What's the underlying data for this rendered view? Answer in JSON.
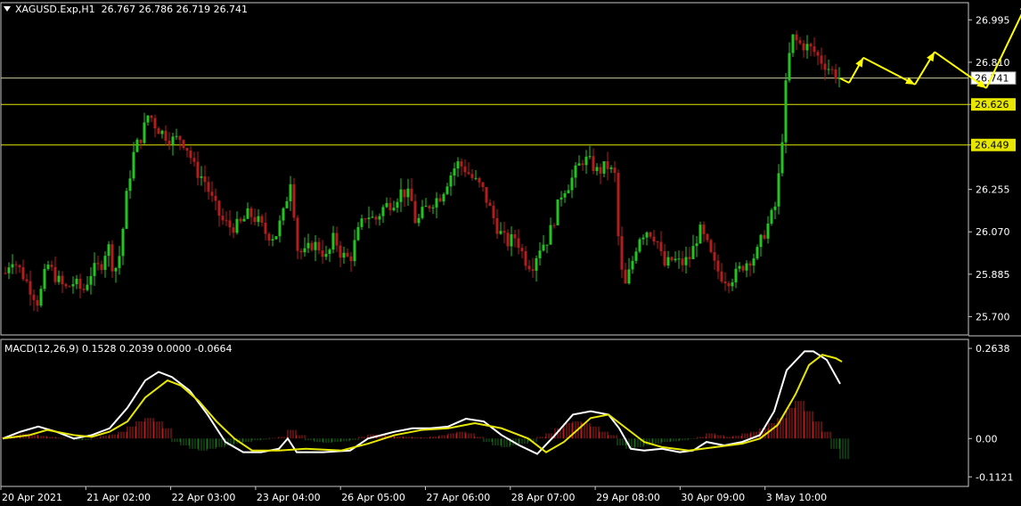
{
  "header": {
    "symbol": "XAGUSD.Exp,H1",
    "ohlc": "26.767 26.786 26.719 26.741"
  },
  "macd_header": "MACD(12,26,9) 0.1528 0.2039 0.0000 -0.0664",
  "colors": {
    "background": "#000000",
    "bull_candle": "#22c322",
    "bear_candle": "#b21e1e",
    "level_line": "#e6e600",
    "macd_line": "#ffffff",
    "signal_line": "#e6e600",
    "hist_positive": "#b21e1e",
    "hist_negative": "#1d6b1d",
    "axis_text": "#ffffff",
    "border": "#c8c8c8",
    "projection_arrow": "#ffff00"
  },
  "chart_data": [
    {
      "type": "candlestick",
      "title": "XAGUSD.Exp,H1",
      "price_axis_ticks": [
        26.995,
        26.81,
        26.626,
        26.449,
        26.255,
        26.07,
        25.885,
        25.7
      ],
      "ylim": [
        25.62,
        27.07
      ],
      "time_axis_labels": [
        "20 Apr 2021",
        "21 Apr 02:00",
        "22 Apr 03:00",
        "23 Apr 04:00",
        "26 Apr 05:00",
        "27 Apr 06:00",
        "28 Apr 07:00",
        "29 Apr 08:00",
        "30 Apr 09:00",
        "3 May 10:00"
      ],
      "current_price": 26.741,
      "horizontal_levels": [
        {
          "price": 26.741,
          "label": "26.741",
          "style": "price"
        },
        {
          "price": 26.626,
          "label": "26.626",
          "style": "level"
        },
        {
          "price": 26.449,
          "label": "26.449",
          "style": "level"
        }
      ],
      "price_path": [
        [
          0,
          25.86
        ],
        [
          10,
          25.96
        ],
        [
          20,
          25.9
        ],
        [
          30,
          25.83
        ],
        [
          40,
          25.76
        ],
        [
          50,
          25.93
        ],
        [
          60,
          25.87
        ],
        [
          70,
          25.82
        ],
        [
          80,
          25.85
        ],
        [
          90,
          25.81
        ],
        [
          100,
          25.9
        ],
        [
          110,
          25.92
        ],
        [
          118,
          26.02
        ],
        [
          125,
          25.89
        ],
        [
          132,
          25.98
        ],
        [
          140,
          26.26
        ],
        [
          148,
          26.43
        ],
        [
          156,
          26.49
        ],
        [
          164,
          26.59
        ],
        [
          172,
          26.53
        ],
        [
          180,
          26.5
        ],
        [
          190,
          26.47
        ],
        [
          200,
          26.48
        ],
        [
          208,
          26.43
        ],
        [
          216,
          26.34
        ],
        [
          226,
          26.3
        ],
        [
          236,
          26.2
        ],
        [
          246,
          26.12
        ],
        [
          256,
          26.09
        ],
        [
          266,
          26.1
        ],
        [
          276,
          26.15
        ],
        [
          286,
          26.12
        ],
        [
          296,
          26.06
        ],
        [
          306,
          26.05
        ],
        [
          316,
          26.16
        ],
        [
          324,
          26.32
        ],
        [
          330,
          26.0
        ],
        [
          338,
          25.97
        ],
        [
          348,
          26.02
        ],
        [
          356,
          26.0
        ],
        [
          364,
          25.95
        ],
        [
          372,
          26.05
        ],
        [
          380,
          25.97
        ],
        [
          390,
          25.95
        ],
        [
          398,
          26.06
        ],
        [
          408,
          26.15
        ],
        [
          418,
          26.12
        ],
        [
          428,
          26.18
        ],
        [
          438,
          26.2
        ],
        [
          448,
          26.25
        ],
        [
          458,
          26.22
        ],
        [
          464,
          26.1
        ],
        [
          472,
          26.16
        ],
        [
          482,
          26.2
        ],
        [
          492,
          26.23
        ],
        [
          500,
          26.3
        ],
        [
          510,
          26.37
        ],
        [
          518,
          26.35
        ],
        [
          528,
          26.3
        ],
        [
          538,
          26.26
        ],
        [
          546,
          26.18
        ],
        [
          556,
          26.08
        ],
        [
          566,
          26.02
        ],
        [
          576,
          26.05
        ],
        [
          586,
          25.95
        ],
        [
          594,
          25.92
        ],
        [
          602,
          26.0
        ],
        [
          612,
          26.04
        ],
        [
          620,
          26.14
        ],
        [
          628,
          26.25
        ],
        [
          636,
          26.28
        ],
        [
          644,
          26.34
        ],
        [
          652,
          26.39
        ],
        [
          660,
          26.37
        ],
        [
          668,
          26.33
        ],
        [
          678,
          26.36
        ],
        [
          688,
          26.31
        ],
        [
          692,
          25.96
        ],
        [
          698,
          25.82
        ],
        [
          706,
          25.93
        ],
        [
          714,
          26.05
        ],
        [
          724,
          26.08
        ],
        [
          734,
          26.04
        ],
        [
          742,
          25.92
        ],
        [
          752,
          25.95
        ],
        [
          762,
          25.93
        ],
        [
          772,
          25.96
        ],
        [
          782,
          26.08
        ],
        [
          790,
          26.02
        ],
        [
          798,
          25.93
        ],
        [
          806,
          25.88
        ],
        [
          814,
          25.86
        ],
        [
          822,
          25.88
        ],
        [
          830,
          25.92
        ],
        [
          838,
          25.95
        ],
        [
          846,
          25.97
        ],
        [
          852,
          26.04
        ],
        [
          860,
          26.11
        ],
        [
          868,
          26.19
        ],
        [
          874,
          26.43
        ],
        [
          880,
          26.76
        ],
        [
          886,
          26.92
        ],
        [
          894,
          26.89
        ],
        [
          902,
          26.88
        ],
        [
          910,
          26.86
        ],
        [
          918,
          26.82
        ],
        [
          926,
          26.79
        ],
        [
          934,
          26.76
        ],
        [
          940,
          26.74
        ]
      ],
      "projection_path": [
        [
          940,
          26.74
        ],
        [
          950,
          26.72
        ],
        [
          966,
          26.83
        ],
        [
          1024,
          26.713
        ],
        [
          1046,
          26.855
        ],
        [
          1104,
          26.697
        ],
        [
          1150,
          27.07
        ]
      ]
    },
    {
      "type": "line",
      "title": "MACD(12,26,9)",
      "y_axis_ticks": [
        0.2638,
        0.0,
        -0.1121
      ],
      "ylim": [
        -0.14,
        0.29
      ],
      "series": [
        {
          "name": "MACD",
          "values": [
            [
              0,
              0.0
            ],
            [
              20,
              0.02
            ],
            [
              40,
              0.035
            ],
            [
              60,
              0.02
            ],
            [
              80,
              0.0
            ],
            [
              100,
              0.01
            ],
            [
              120,
              0.03
            ],
            [
              140,
              0.09
            ],
            [
              160,
              0.17
            ],
            [
              175,
              0.195
            ],
            [
              190,
              0.18
            ],
            [
              210,
              0.14
            ],
            [
              230,
              0.07
            ],
            [
              250,
              -0.01
            ],
            [
              270,
              -0.04
            ],
            [
              290,
              -0.04
            ],
            [
              310,
              -0.03
            ],
            [
              320,
              0.0
            ],
            [
              330,
              -0.04
            ],
            [
              360,
              -0.04
            ],
            [
              390,
              -0.035
            ],
            [
              410,
              0.0
            ],
            [
              440,
              0.02
            ],
            [
              460,
              0.03
            ],
            [
              480,
              0.03
            ],
            [
              500,
              0.035
            ],
            [
              520,
              0.058
            ],
            [
              540,
              0.05
            ],
            [
              560,
              0.01
            ],
            [
              580,
              -0.02
            ],
            [
              600,
              -0.045
            ],
            [
              620,
              0.01
            ],
            [
              640,
              0.07
            ],
            [
              660,
              0.08
            ],
            [
              680,
              0.07
            ],
            [
              692,
              0.03
            ],
            [
              705,
              -0.03
            ],
            [
              720,
              -0.035
            ],
            [
              740,
              -0.03
            ],
            [
              760,
              -0.04
            ],
            [
              775,
              -0.035
            ],
            [
              790,
              -0.01
            ],
            [
              810,
              -0.02
            ],
            [
              830,
              -0.01
            ],
            [
              850,
              0.01
            ],
            [
              866,
              0.08
            ],
            [
              880,
              0.2
            ],
            [
              900,
              0.255
            ],
            [
              910,
              0.255
            ],
            [
              925,
              0.23
            ],
            [
              940,
              0.16
            ]
          ]
        },
        {
          "name": "Signal",
          "values": [
            [
              0,
              0.0
            ],
            [
              30,
              0.01
            ],
            [
              50,
              0.025
            ],
            [
              80,
              0.01
            ],
            [
              100,
              0.005
            ],
            [
              120,
              0.02
            ],
            [
              140,
              0.05
            ],
            [
              160,
              0.12
            ],
            [
              185,
              0.17
            ],
            [
              200,
              0.155
            ],
            [
              220,
              0.11
            ],
            [
              240,
              0.05
            ],
            [
              260,
              0.0
            ],
            [
              280,
              -0.035
            ],
            [
              310,
              -0.035
            ],
            [
              340,
              -0.03
            ],
            [
              380,
              -0.035
            ],
            [
              410,
              -0.015
            ],
            [
              440,
              0.01
            ],
            [
              470,
              0.025
            ],
            [
              500,
              0.03
            ],
            [
              530,
              0.045
            ],
            [
              560,
              0.03
            ],
            [
              590,
              0.0
            ],
            [
              610,
              -0.04
            ],
            [
              630,
              -0.01
            ],
            [
              660,
              0.06
            ],
            [
              680,
              0.07
            ],
            [
              700,
              0.03
            ],
            [
              720,
              -0.01
            ],
            [
              740,
              -0.025
            ],
            [
              770,
              -0.035
            ],
            [
              800,
              -0.025
            ],
            [
              830,
              -0.015
            ],
            [
              850,
              0.0
            ],
            [
              870,
              0.04
            ],
            [
              890,
              0.13
            ],
            [
              905,
              0.215
            ],
            [
              920,
              0.245
            ],
            [
              935,
              0.235
            ],
            [
              942,
              0.225
            ]
          ]
        }
      ],
      "histogram": [
        [
          0,
          0.005
        ],
        [
          10,
          0.01
        ],
        [
          20,
          0.015
        ],
        [
          30,
          0.012
        ],
        [
          40,
          0.008
        ],
        [
          50,
          0.005
        ],
        [
          60,
          0.003
        ],
        [
          70,
          0.0
        ],
        [
          80,
          -0.005
        ],
        [
          90,
          -0.004
        ],
        [
          100,
          0.002
        ],
        [
          110,
          0.008
        ],
        [
          120,
          0.012
        ],
        [
          130,
          0.02
        ],
        [
          140,
          0.035
        ],
        [
          150,
          0.05
        ],
        [
          160,
          0.06
        ],
        [
          170,
          0.05
        ],
        [
          180,
          0.03
        ],
        [
          190,
          -0.01
        ],
        [
          200,
          -0.02
        ],
        [
          210,
          -0.03
        ],
        [
          220,
          -0.035
        ],
        [
          230,
          -0.03
        ],
        [
          240,
          -0.025
        ],
        [
          250,
          -0.02
        ],
        [
          260,
          -0.015
        ],
        [
          270,
          -0.01
        ],
        [
          280,
          -0.005
        ],
        [
          290,
          -0.003
        ],
        [
          300,
          0.002
        ],
        [
          310,
          0.005
        ],
        [
          320,
          0.025
        ],
        [
          330,
          0.01
        ],
        [
          340,
          -0.005
        ],
        [
          350,
          -0.01
        ],
        [
          360,
          -0.012
        ],
        [
          370,
          -0.01
        ],
        [
          380,
          -0.008
        ],
        [
          390,
          -0.004
        ],
        [
          400,
          0.005
        ],
        [
          410,
          0.012
        ],
        [
          420,
          0.01
        ],
        [
          430,
          0.008
        ],
        [
          440,
          0.006
        ],
        [
          450,
          0.005
        ],
        [
          460,
          0.004
        ],
        [
          470,
          0.003
        ],
        [
          480,
          0.006
        ],
        [
          490,
          0.01
        ],
        [
          500,
          0.015
        ],
        [
          510,
          0.02
        ],
        [
          520,
          0.015
        ],
        [
          530,
          0.005
        ],
        [
          540,
          -0.01
        ],
        [
          550,
          -0.02
        ],
        [
          560,
          -0.025
        ],
        [
          570,
          -0.02
        ],
        [
          580,
          -0.015
        ],
        [
          590,
          -0.01
        ],
        [
          600,
          0.005
        ],
        [
          610,
          0.015
        ],
        [
          620,
          0.03
        ],
        [
          630,
          0.045
        ],
        [
          640,
          0.05
        ],
        [
          650,
          0.045
        ],
        [
          660,
          0.035
        ],
        [
          670,
          0.02
        ],
        [
          680,
          0.01
        ],
        [
          690,
          -0.02
        ],
        [
          700,
          -0.03
        ],
        [
          710,
          -0.025
        ],
        [
          720,
          -0.02
        ],
        [
          730,
          -0.015
        ],
        [
          740,
          -0.01
        ],
        [
          750,
          -0.008
        ],
        [
          760,
          -0.005
        ],
        [
          770,
          -0.002
        ],
        [
          780,
          0.005
        ],
        [
          790,
          0.015
        ],
        [
          800,
          0.01
        ],
        [
          810,
          0.005
        ],
        [
          820,
          0.008
        ],
        [
          830,
          0.015
        ],
        [
          840,
          0.02
        ],
        [
          850,
          0.03
        ],
        [
          860,
          0.045
        ],
        [
          870,
          0.06
        ],
        [
          880,
          0.09
        ],
        [
          890,
          0.11
        ],
        [
          900,
          0.08
        ],
        [
          910,
          0.05
        ],
        [
          920,
          0.02
        ],
        [
          930,
          -0.03
        ],
        [
          940,
          -0.06
        ]
      ]
    }
  ]
}
